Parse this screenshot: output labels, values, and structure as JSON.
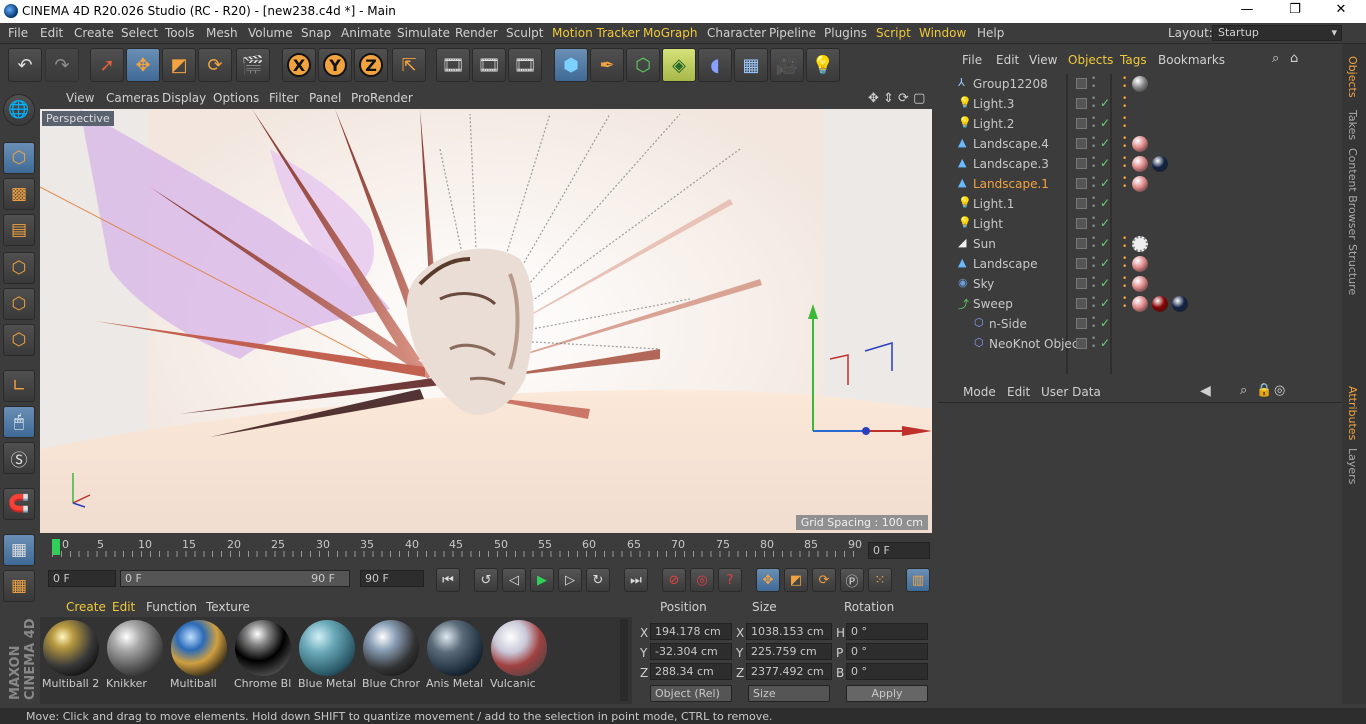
{
  "window": {
    "title": "CINEMA 4D R20.026 Studio (RC - R20) - [new238.c4d *] - Main"
  },
  "menu": [
    "File",
    "Edit",
    "Create",
    "Select",
    "Tools",
    "Mesh",
    "Volume",
    "Snap",
    "Animate",
    "Simulate",
    "Render",
    "Sculpt",
    "Motion Tracker",
    "MoGraph",
    "Character",
    "Pipeline",
    "Plugins",
    "Script",
    "Window",
    "Help"
  ],
  "layout": {
    "label": "Layout:",
    "value": "Startup"
  },
  "viewport": {
    "menu": [
      "View",
      "Cameras",
      "Display",
      "Options",
      "Filter",
      "Panel",
      "ProRender"
    ],
    "camera_label": "Perspective",
    "grid_spacing": "Grid Spacing : 100 cm"
  },
  "timeline": {
    "ticks": [
      "0",
      "5",
      "10",
      "15",
      "20",
      "25",
      "30",
      "35",
      "40",
      "45",
      "50",
      "55",
      "60",
      "65",
      "70",
      "75",
      "80",
      "85",
      "90"
    ],
    "current_frame": "0 F",
    "start": "0 F",
    "range_start": "0 F",
    "range_end": "90 F",
    "end": "90 F"
  },
  "materials": {
    "tabs": [
      "Create",
      "Edit",
      "Function",
      "Texture"
    ],
    "items": [
      {
        "name": "Multiball 2"
      },
      {
        "name": "Knikker"
      },
      {
        "name": "Multiball"
      },
      {
        "name": "Chrome Bla"
      },
      {
        "name": "Blue Metal"
      },
      {
        "name": "Blue Chron"
      },
      {
        "name": "Anis Metal"
      },
      {
        "name": "Vulcanic"
      }
    ]
  },
  "coords": {
    "headers": [
      "Position",
      "Size",
      "Rotation"
    ],
    "rows": [
      {
        "axis": "X",
        "pos": "194.178 cm",
        "saxis": "X",
        "size": "1038.153 cm",
        "raxis": "H",
        "rot": "0 °"
      },
      {
        "axis": "Y",
        "pos": "-32.304 cm",
        "saxis": "Y",
        "size": "225.759 cm",
        "raxis": "P",
        "rot": "0 °"
      },
      {
        "axis": "Z",
        "pos": "288.34 cm",
        "saxis": "Z",
        "size": "2377.492 cm",
        "raxis": "B",
        "rot": "0 °"
      }
    ],
    "mode": "Object (Rel)",
    "size_mode": "Size",
    "apply": "Apply"
  },
  "objects": {
    "menu": [
      "File",
      "Edit",
      "View",
      "Objects",
      "Tags",
      "Bookmarks"
    ],
    "items": [
      {
        "name": "Group12208",
        "icon": "group-icon",
        "indent": 0,
        "selected": false
      },
      {
        "name": "Light.3",
        "icon": "light-icon",
        "indent": 0,
        "selected": false
      },
      {
        "name": "Light.2",
        "icon": "light-icon",
        "indent": 0,
        "selected": false
      },
      {
        "name": "Landscape.4",
        "icon": "landscape-icon",
        "indent": 0,
        "selected": false
      },
      {
        "name": "Landscape.3",
        "icon": "landscape-icon",
        "indent": 0,
        "selected": false
      },
      {
        "name": "Landscape.1",
        "icon": "landscape-icon",
        "indent": 0,
        "selected": true
      },
      {
        "name": "Light.1",
        "icon": "light-icon",
        "indent": 0,
        "selected": false
      },
      {
        "name": "Light",
        "icon": "light-icon",
        "indent": 0,
        "selected": false
      },
      {
        "name": "Sun",
        "icon": "sun-icon",
        "indent": 0,
        "selected": false
      },
      {
        "name": "Landscape",
        "icon": "landscape-icon",
        "indent": 0,
        "selected": false
      },
      {
        "name": "Sky",
        "icon": "sky-icon",
        "indent": 0,
        "selected": false
      },
      {
        "name": "Sweep",
        "icon": "sweep-icon",
        "indent": 0,
        "selected": false
      },
      {
        "name": "n-Side",
        "icon": "spline-icon",
        "indent": 1,
        "selected": false
      },
      {
        "name": "NeoKnot Object",
        "icon": "spline-icon",
        "indent": 1,
        "selected": false
      }
    ]
  },
  "attributes": {
    "menu": [
      "Mode",
      "Edit",
      "User Data"
    ]
  },
  "side_tabs": [
    "Objects",
    "Takes",
    "Content Browser",
    "Structure",
    "Attributes",
    "Layers"
  ],
  "status": "Move: Click and drag to move elements. Hold down SHIFT to quantize movement / add to the selection in point mode, CTRL to remove.",
  "brand": "MAXON CINEMA 4D",
  "colors": {
    "accent": "#f2a340",
    "selected": "#f0c93a",
    "bg": "#3c3c3c"
  }
}
